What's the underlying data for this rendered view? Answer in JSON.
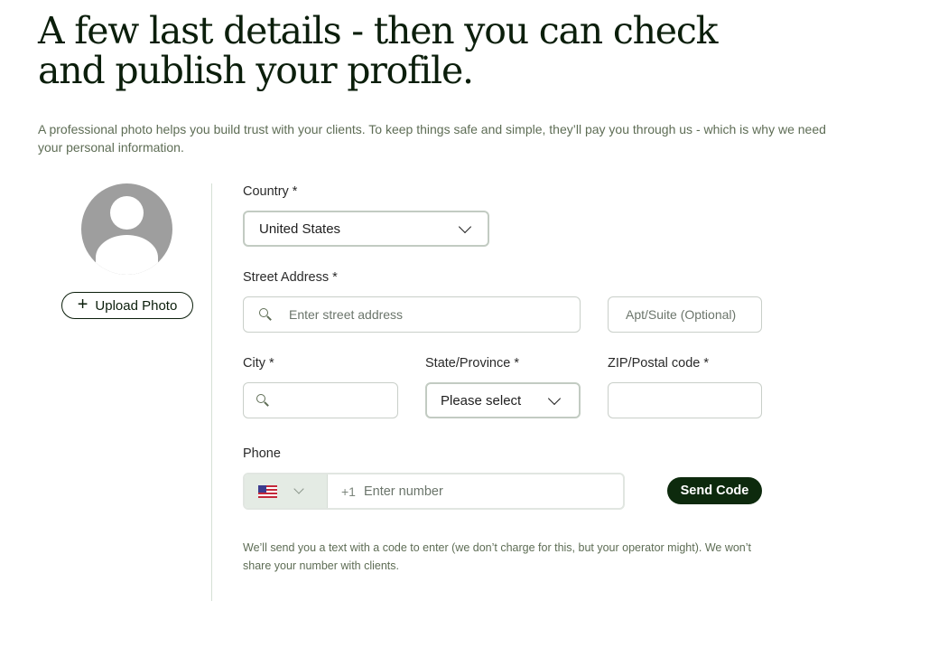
{
  "header": {
    "title": "A few last details - then you can check and publish your profile.",
    "intro": "A professional photo helps you build trust with your clients. To keep things safe and simple, they’ll pay you through us - which is why we need your personal information."
  },
  "photo": {
    "upload_label": "Upload Photo",
    "plus_glyph": "+"
  },
  "form": {
    "country": {
      "label": "Country *",
      "value": "United States"
    },
    "street": {
      "label": "Street Address *",
      "placeholder": "Enter street address"
    },
    "apt": {
      "placeholder": "Apt/Suite (Optional)"
    },
    "city": {
      "label": "City *",
      "value": ""
    },
    "state": {
      "label": "State/Province *",
      "value": "Please select"
    },
    "zip": {
      "label": "ZIP/Postal code *",
      "value": ""
    },
    "phone": {
      "label": "Phone",
      "country_code": "+1",
      "placeholder": "Enter number",
      "send_label": "Send Code",
      "note": "We’ll send you a text with a code to enter (we don’t charge for this, but your operator might). We won’t share your number with clients."
    }
  },
  "colors": {
    "brand_dark": "#0d2a0d",
    "muted_text": "#5e6d55",
    "avatar_gray": "#9e9e9e"
  },
  "icons": [
    "search-icon",
    "chevron-down-icon",
    "plus-icon",
    "us-flag-icon",
    "avatar-placeholder-icon"
  ]
}
